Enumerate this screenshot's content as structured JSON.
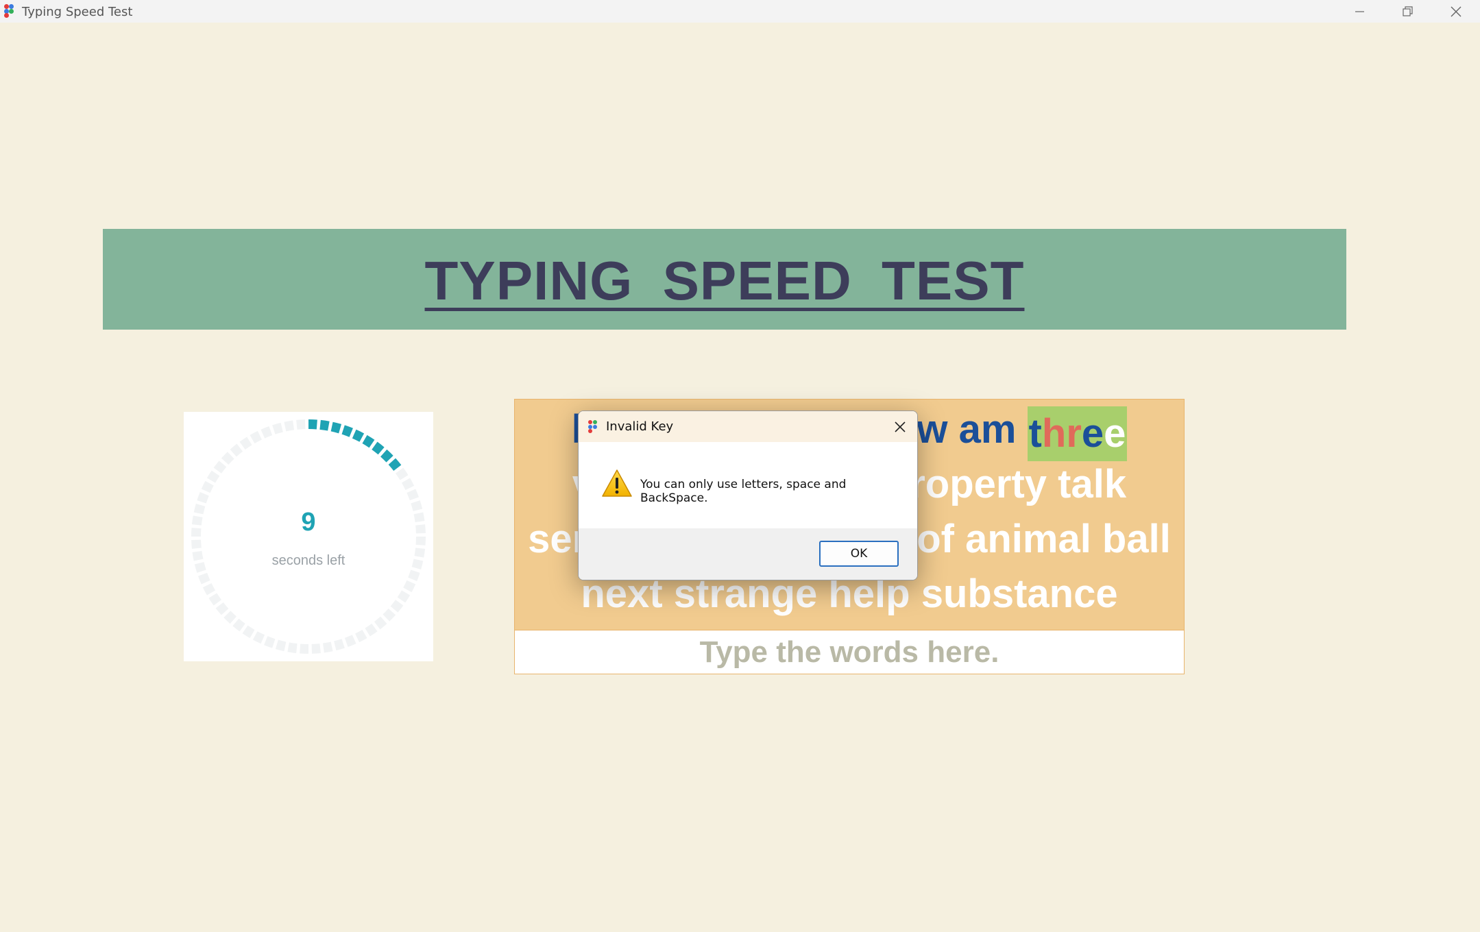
{
  "window": {
    "title": "Typing Speed Test"
  },
  "header": {
    "title": "TYPING  SPEED  TEST"
  },
  "timer": {
    "seconds": "9",
    "label": "seconds left",
    "accent_color": "#1fa3b4",
    "remaining_fraction": 0.15
  },
  "words": {
    "line1_start": "la",
    "line1_end": "ow am ",
    "current_word_letters": [
      "t",
      "h",
      "r",
      "e",
      "e"
    ],
    "current_word_status": [
      "correct",
      "wrong",
      "wrong",
      "correct",
      "pending"
    ],
    "line2_start": "v",
    "line2_end": "roperty talk",
    "line3_start": "ser",
    "line3_end": "of animal ball",
    "line4": "next strange help substance"
  },
  "input": {
    "placeholder": "Type the words here."
  },
  "dialog": {
    "title": "Invalid Key",
    "message": "You can only use letters, space and BackSpace.",
    "ok_label": "OK",
    "icon": "warning-icon"
  },
  "colors": {
    "background": "#f5f0df",
    "banner": "#83b49a",
    "word_panel": "#f1cb8f",
    "typed": "#1b4f99",
    "error": "#e06a5a",
    "highlight": "#a8cf6c"
  }
}
